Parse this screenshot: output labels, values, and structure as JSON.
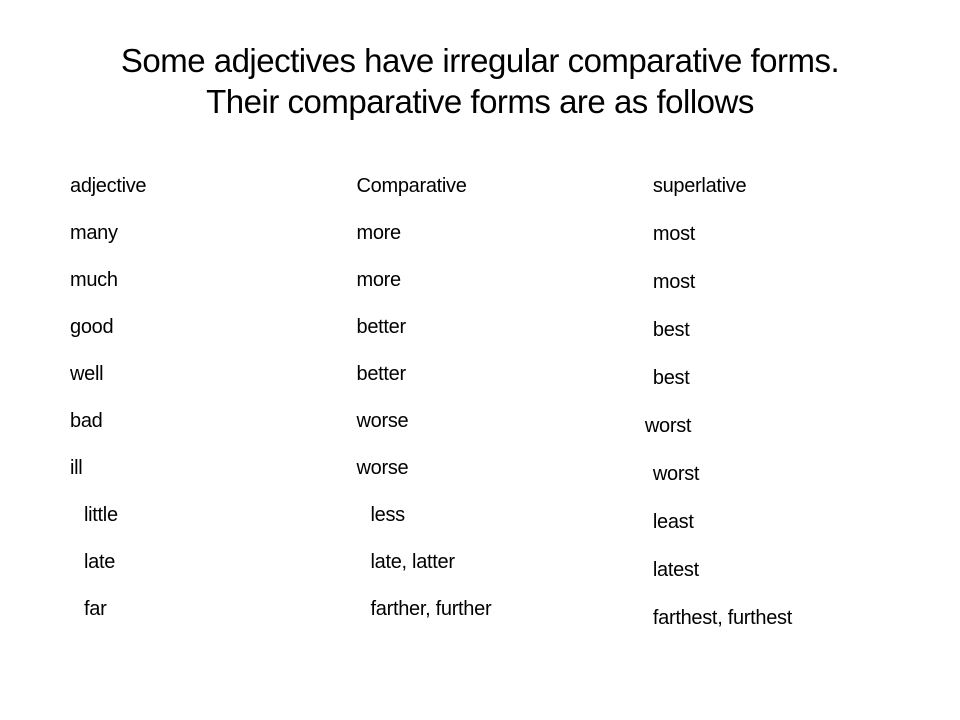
{
  "title_line1": "Some adjectives have irregular comparative forms.",
  "title_line2": "Their comparative forms are as follows",
  "headers": {
    "adjective": "adjective",
    "comparative": "Comparative",
    "superlative": "superlative"
  },
  "rows": [
    {
      "adj": "many",
      "comp": "more",
      "sup": "most"
    },
    {
      "adj": "much",
      "comp": "more",
      "sup": "most"
    },
    {
      "adj": "good",
      "comp": "better",
      "sup": "best"
    },
    {
      "adj": "well",
      "comp": "better",
      "sup": "best"
    },
    {
      "adj": "bad",
      "comp": "worse",
      "sup": "worst"
    },
    {
      "adj": "ill",
      "comp": "worse",
      "sup": "worst"
    },
    {
      "adj": "little",
      "comp": "less",
      "sup": "least"
    },
    {
      "adj": "late",
      "comp": "late, latter",
      "sup": "latest"
    },
    {
      "adj": "far",
      "comp": "farther, further",
      "sup": "farthest, furthest"
    }
  ]
}
